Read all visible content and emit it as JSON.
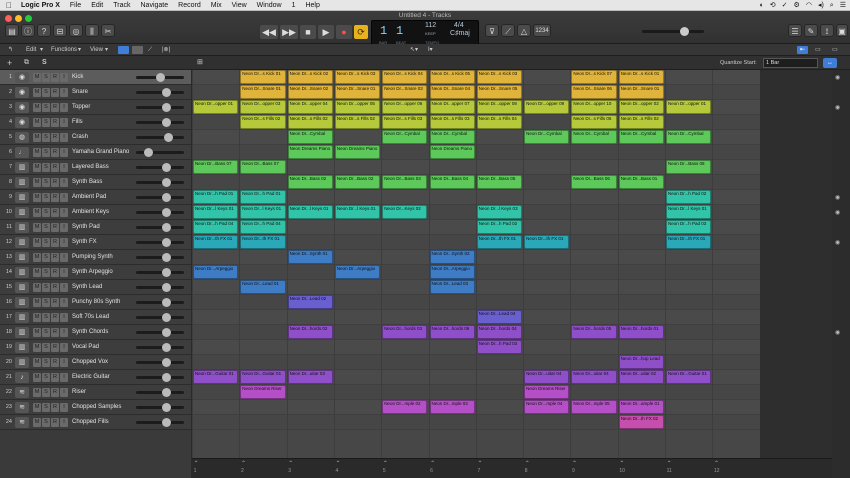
{
  "menubar": {
    "app": "Logic Pro X",
    "items": [
      "File",
      "Edit",
      "Track",
      "Navigate",
      "Record",
      "Mix",
      "View",
      "Window",
      "1",
      "Help"
    ],
    "clock": "⏱"
  },
  "window": {
    "title": "Untitled 4 - Tracks"
  },
  "lcd": {
    "bar": "1",
    "beat": "1",
    "bar_label": "BAR",
    "beat_label": "BEAT",
    "tempo": "112",
    "tempo_label": "KEEP",
    "tempo_sub": "TEMPO",
    "signature": "4/4",
    "key": "C♯maj"
  },
  "countin": "1234",
  "toolbar": {
    "edit": "Edit",
    "functions": "Functions",
    "view": "View",
    "quantize_label": "Quantize Start:",
    "quantize_value": "1 Bar"
  },
  "colors": {
    "yellow": "#e0b43a",
    "lime": "#b5c93a",
    "green": "#5cc95a",
    "cyan": "#32c4a8",
    "teal": "#2aa8b7",
    "blue": "#3e7cc6",
    "indigo": "#6a5fcf",
    "purple": "#8f4fc8",
    "magenta": "#b54fc8",
    "pink": "#c64fae"
  },
  "tracks": [
    {
      "num": "1",
      "name": "Kick",
      "icon": "drum-icon",
      "sel": true
    },
    {
      "num": "2",
      "name": "Snare",
      "icon": "drum-icon"
    },
    {
      "num": "3",
      "name": "Topper",
      "icon": "drum-icon"
    },
    {
      "num": "4",
      "name": "Fills",
      "icon": "drum-icon"
    },
    {
      "num": "5",
      "name": "Crash",
      "icon": "cymbal-icon"
    },
    {
      "num": "6",
      "name": "Yamaha Grand Piano",
      "icon": "piano-icon"
    },
    {
      "num": "7",
      "name": "Layered Bass",
      "icon": "keyboard-icon"
    },
    {
      "num": "8",
      "name": "Synth Bass",
      "icon": "keyboard-icon"
    },
    {
      "num": "9",
      "name": "Ambient Pad",
      "icon": "keyboard-icon"
    },
    {
      "num": "10",
      "name": "Ambient Keys",
      "icon": "keyboard-icon"
    },
    {
      "num": "11",
      "name": "Synth Pad",
      "icon": "keyboard-icon"
    },
    {
      "num": "12",
      "name": "Synth FX",
      "icon": "keyboard-icon"
    },
    {
      "num": "13",
      "name": "Pumping Synth",
      "icon": "keyboard-icon"
    },
    {
      "num": "14",
      "name": "Synth Arpeggio",
      "icon": "keyboard-icon"
    },
    {
      "num": "15",
      "name": "Synth Lead",
      "icon": "keyboard-icon"
    },
    {
      "num": "16",
      "name": "Punchy 80s Synth",
      "icon": "keyboard-icon"
    },
    {
      "num": "17",
      "name": "Soft 70s Lead",
      "icon": "keyboard-icon"
    },
    {
      "num": "18",
      "name": "Synth Chords",
      "icon": "keyboard-icon"
    },
    {
      "num": "19",
      "name": "Vocal Pad",
      "icon": "keyboard-icon"
    },
    {
      "num": "20",
      "name": "Chopped Vox",
      "icon": "keyboard-icon"
    },
    {
      "num": "21",
      "name": "Electric Guitar",
      "icon": "guitar-icon"
    },
    {
      "num": "22",
      "name": "Riser",
      "icon": "waveform-icon"
    },
    {
      "num": "23",
      "name": "Chopped Samples",
      "icon": "waveform-icon"
    },
    {
      "num": "24",
      "name": "Chopped Fills",
      "icon": "waveform-icon"
    }
  ],
  "bars": [
    "1",
    "2",
    "3",
    "4",
    "5",
    "6",
    "7",
    "8",
    "9",
    "10",
    "11",
    "12"
  ],
  "regions": [
    {
      "t": 0,
      "b": 2,
      "l": 1,
      "c": "yellow",
      "n": "Neon Dr...s Kick 01"
    },
    {
      "t": 0,
      "b": 3,
      "l": 1,
      "c": "yellow",
      "n": "Neon Dr...s Kick 02"
    },
    {
      "t": 0,
      "b": 4,
      "l": 1,
      "c": "yellow",
      "n": "Neon Dr...s Kick 03"
    },
    {
      "t": 0,
      "b": 5,
      "l": 1,
      "c": "yellow",
      "n": "Neon Dr...s Kick 04"
    },
    {
      "t": 0,
      "b": 6,
      "l": 1,
      "c": "yellow",
      "n": "Neon Dr...s Kick 05"
    },
    {
      "t": 0,
      "b": 7,
      "l": 1,
      "c": "yellow",
      "n": "Neon Dr...s Kick 03"
    },
    {
      "t": 0,
      "b": 9,
      "l": 1,
      "c": "yellow",
      "n": "Neon Dr...s Kick 07"
    },
    {
      "t": 0,
      "b": 10,
      "l": 1,
      "c": "yellow",
      "n": "Neon Dr...s Kick 01"
    },
    {
      "t": 1,
      "b": 2,
      "l": 1,
      "c": "yellow",
      "n": "Neon Dr...Snare 01"
    },
    {
      "t": 1,
      "b": 3,
      "l": 1,
      "c": "yellow",
      "n": "Neon Dr...Snare 02"
    },
    {
      "t": 1,
      "b": 4,
      "l": 1,
      "c": "yellow",
      "n": "Neon Dr...Snare 01"
    },
    {
      "t": 1,
      "b": 5,
      "l": 1,
      "c": "yellow",
      "n": "Neon Dr...Snare 03"
    },
    {
      "t": 1,
      "b": 6,
      "l": 1,
      "c": "yellow",
      "n": "Neon Dr...Snare 04"
    },
    {
      "t": 1,
      "b": 7,
      "l": 1,
      "c": "yellow",
      "n": "Neon Dr...Snare 05"
    },
    {
      "t": 1,
      "b": 9,
      "l": 1,
      "c": "yellow",
      "n": "Neon Dr...Snare 06"
    },
    {
      "t": 1,
      "b": 10,
      "l": 1,
      "c": "yellow",
      "n": "Neon Dr...Snare 01"
    },
    {
      "t": 2,
      "b": 1,
      "l": 1,
      "c": "lime",
      "n": "Neon Dr...opper 01"
    },
    {
      "t": 2,
      "b": 2,
      "l": 1,
      "c": "lime",
      "n": "Neon Dr...opper 03"
    },
    {
      "t": 2,
      "b": 3,
      "l": 1,
      "c": "lime",
      "n": "Neon Dr...opper 04"
    },
    {
      "t": 2,
      "b": 4,
      "l": 1,
      "c": "lime",
      "n": "Neon Dr...opper 05"
    },
    {
      "t": 2,
      "b": 5,
      "l": 1,
      "c": "lime",
      "n": "Neon Dr...opper 06"
    },
    {
      "t": 2,
      "b": 6,
      "l": 1,
      "c": "lime",
      "n": "Neon Dr...opper 07"
    },
    {
      "t": 2,
      "b": 7,
      "l": 1,
      "c": "lime",
      "n": "Neon Dr...opper 08"
    },
    {
      "t": 2,
      "b": 8,
      "l": 1,
      "c": "lime",
      "n": "Neon Dr...opper 09"
    },
    {
      "t": 2,
      "b": 9,
      "l": 1,
      "c": "lime",
      "n": "Neon Dr...opper 10"
    },
    {
      "t": 2,
      "b": 10,
      "l": 1,
      "c": "lime",
      "n": "Neon Dr...opper 02"
    },
    {
      "t": 2,
      "b": 11,
      "l": 1,
      "c": "lime",
      "n": "Neon Dr...opper 01"
    },
    {
      "t": 3,
      "b": 2,
      "l": 1,
      "c": "lime",
      "n": "Neon Dr...s Fills 02"
    },
    {
      "t": 3,
      "b": 3,
      "l": 1,
      "c": "lime",
      "n": "Neon Dr...s Fills 02"
    },
    {
      "t": 3,
      "b": 4,
      "l": 1,
      "c": "lime",
      "n": "Neon Dr...s Fills 02"
    },
    {
      "t": 3,
      "b": 5,
      "l": 1,
      "c": "lime",
      "n": "Neon Dr...s Fills 03"
    },
    {
      "t": 3,
      "b": 6,
      "l": 1,
      "c": "lime",
      "n": "Neon Dr...s Fills 03"
    },
    {
      "t": 3,
      "b": 7,
      "l": 1,
      "c": "lime",
      "n": "Neon Dr...s Fills 04"
    },
    {
      "t": 3,
      "b": 9,
      "l": 1,
      "c": "lime",
      "n": "Neon Dr...s Fills 05"
    },
    {
      "t": 3,
      "b": 10,
      "l": 1,
      "c": "lime",
      "n": "Neon Dr...s Fills 02"
    },
    {
      "t": 4,
      "b": 3,
      "l": 1,
      "c": "green",
      "n": "Neon Dr...Cymbal"
    },
    {
      "t": 4,
      "b": 5,
      "l": 1,
      "c": "green",
      "n": "Neon Dr...Cymbal"
    },
    {
      "t": 4,
      "b": 6,
      "l": 1,
      "c": "green",
      "n": "Neon Dr...Cymbal"
    },
    {
      "t": 4,
      "b": 8,
      "l": 1,
      "c": "green",
      "n": "Neon Dr...Cymbal"
    },
    {
      "t": 4,
      "b": 9,
      "l": 1,
      "c": "green",
      "n": "Neon Dr...Cymbal"
    },
    {
      "t": 4,
      "b": 10,
      "l": 1,
      "c": "green",
      "n": "Neon Dr...Cymbal"
    },
    {
      "t": 4,
      "b": 11,
      "l": 1,
      "c": "green",
      "n": "Neon Dr...Cymbal"
    },
    {
      "t": 5,
      "b": 3,
      "l": 1,
      "c": "green",
      "n": "Neon Dreams Piano"
    },
    {
      "t": 5,
      "b": 4,
      "l": 1,
      "c": "green",
      "n": "Neon Dreams Piano"
    },
    {
      "t": 5,
      "b": 6,
      "l": 1,
      "c": "green",
      "n": "Neon Dreams Piano"
    },
    {
      "t": 6,
      "b": 1,
      "l": 1,
      "c": "green",
      "n": "Neon Dr...Bass 07"
    },
    {
      "t": 6,
      "b": 2,
      "l": 1,
      "c": "green",
      "n": "Neon Dr...Bass 07"
    },
    {
      "t": 6,
      "b": 11,
      "l": 1,
      "c": "green",
      "n": "Neon Dr...Bass 08"
    },
    {
      "t": 7,
      "b": 3,
      "l": 1,
      "c": "green",
      "n": "Neon Dr...Bass 02"
    },
    {
      "t": 7,
      "b": 4,
      "l": 1,
      "c": "green",
      "n": "Neon Dr...Bass 02"
    },
    {
      "t": 7,
      "b": 5,
      "l": 1,
      "c": "green",
      "n": "Neon Dr...Bass 03"
    },
    {
      "t": 7,
      "b": 6,
      "l": 1,
      "c": "green",
      "n": "Neon Dr...Bass 04"
    },
    {
      "t": 7,
      "b": 7,
      "l": 1,
      "c": "green",
      "n": "Neon Dr...Bass 05"
    },
    {
      "t": 7,
      "b": 9,
      "l": 1,
      "c": "green",
      "n": "Neon Dr...Bass 06"
    },
    {
      "t": 7,
      "b": 10,
      "l": 1,
      "c": "green",
      "n": "Neon Dr...Bass 01"
    },
    {
      "t": 8,
      "b": 1,
      "l": 1,
      "c": "cyan",
      "n": "Neon Dr...h Pad 01"
    },
    {
      "t": 8,
      "b": 2,
      "l": 1,
      "c": "cyan",
      "n": "Neon Dr...h Pad 01"
    },
    {
      "t": 8,
      "b": 11,
      "l": 1,
      "c": "cyan",
      "n": "Neon Dr...h Pad 02"
    },
    {
      "t": 9,
      "b": 1,
      "l": 1,
      "c": "cyan",
      "n": "Neon Dr...l Keys 01"
    },
    {
      "t": 9,
      "b": 2,
      "l": 1,
      "c": "cyan",
      "n": "Neon Dr...l Keys 01"
    },
    {
      "t": 9,
      "b": 3,
      "l": 1,
      "c": "cyan",
      "n": "Neon Dr...l Keys 01"
    },
    {
      "t": 9,
      "b": 4,
      "l": 1,
      "c": "cyan",
      "n": "Neon Dr...l Keys 01"
    },
    {
      "t": 9,
      "b": 5,
      "l": 1,
      "c": "cyan",
      "n": "Neon Dr...Keys 02"
    },
    {
      "t": 9,
      "b": 7,
      "l": 1,
      "c": "cyan",
      "n": "Neon Dr...l Keys 03"
    },
    {
      "t": 9,
      "b": 11,
      "l": 1,
      "c": "cyan",
      "n": "Neon Dr...l Keys 01"
    },
    {
      "t": 10,
      "b": 1,
      "l": 1,
      "c": "cyan",
      "n": "Neon Dr...h Pad 04"
    },
    {
      "t": 10,
      "b": 2,
      "l": 1,
      "c": "cyan",
      "n": "Neon Dr...h Pad 04"
    },
    {
      "t": 10,
      "b": 7,
      "l": 1,
      "c": "cyan",
      "n": "Neon Dr...h Pad 02"
    },
    {
      "t": 10,
      "b": 11,
      "l": 1,
      "c": "cyan",
      "n": "Neon Dr...h Pad 03"
    },
    {
      "t": 11,
      "b": 1,
      "l": 1,
      "c": "teal",
      "n": "Neon Dr...th FX 01"
    },
    {
      "t": 11,
      "b": 2,
      "l": 1,
      "c": "teal",
      "n": "Neon Dr...th FX 01"
    },
    {
      "t": 11,
      "b": 7,
      "l": 1,
      "c": "teal",
      "n": "Neon Dr...th FX 01"
    },
    {
      "t": 11,
      "b": 8,
      "l": 1,
      "c": "teal",
      "n": "Neon Dr...th FX 01"
    },
    {
      "t": 11,
      "b": 11,
      "l": 1,
      "c": "teal",
      "n": "Neon Dr...th FX 01"
    },
    {
      "t": 12,
      "b": 3,
      "l": 1,
      "c": "blue",
      "n": "Neon Dr...Synth 01"
    },
    {
      "t": 12,
      "b": 6,
      "l": 1,
      "c": "blue",
      "n": "Neon Dr...Synth 02"
    },
    {
      "t": 13,
      "b": 1,
      "l": 1,
      "c": "blue",
      "n": "Neon Dr...Arpeggio"
    },
    {
      "t": 13,
      "b": 4,
      "l": 1,
      "c": "blue",
      "n": "Neon Dr...Arpeggio"
    },
    {
      "t": 13,
      "b": 6,
      "l": 1,
      "c": "blue",
      "n": "Neon Dr...Arpeggio"
    },
    {
      "t": 14,
      "b": 2,
      "l": 1,
      "c": "blue",
      "n": "Neon Dr...Lead 01"
    },
    {
      "t": 14,
      "b": 6,
      "l": 1,
      "c": "blue",
      "n": "Neon Dr...Lead 03"
    },
    {
      "t": 15,
      "b": 3,
      "l": 1,
      "c": "indigo",
      "n": "Neon Dr...Lead 02"
    },
    {
      "t": 16,
      "b": 7,
      "l": 1,
      "c": "indigo",
      "n": "Neon Dr...Lead 04"
    },
    {
      "t": 17,
      "b": 3,
      "l": 1,
      "c": "purple",
      "n": "Neon Dr...hords 02"
    },
    {
      "t": 17,
      "b": 5,
      "l": 1,
      "c": "purple",
      "n": "Neon Dr...hords 03"
    },
    {
      "t": 17,
      "b": 6,
      "l": 1,
      "c": "purple",
      "n": "Neon Dr...hords 06"
    },
    {
      "t": 17,
      "b": 7,
      "l": 1,
      "c": "purple",
      "n": "Neon Dr...hords 04"
    },
    {
      "t": 17,
      "b": 9,
      "l": 1,
      "c": "purple",
      "n": "Neon Dr...hords 05"
    },
    {
      "t": 17,
      "b": 10,
      "l": 1,
      "c": "purple",
      "n": "Neon Dr...hords 01"
    },
    {
      "t": 18,
      "b": 7,
      "l": 1,
      "c": "purple",
      "n": "Neon Dr...h Pad 03"
    },
    {
      "t": 19,
      "b": 10,
      "l": 1,
      "c": "purple",
      "n": "Neon Dr...hop Lead"
    },
    {
      "t": 20,
      "b": 1,
      "l": 1,
      "c": "purple",
      "n": "Neon Dr...Guitar 01"
    },
    {
      "t": 20,
      "b": 2,
      "l": 1,
      "c": "purple",
      "n": "Neon Dr...Guitar 01"
    },
    {
      "t": 20,
      "b": 3,
      "l": 1,
      "c": "purple",
      "n": "Neon Dr...uitar 03"
    },
    {
      "t": 20,
      "b": 8,
      "l": 1,
      "c": "purple",
      "n": "Neon Dr...uitar 04"
    },
    {
      "t": 20,
      "b": 9,
      "l": 1,
      "c": "purple",
      "n": "Neon Dr...uitar 04"
    },
    {
      "t": 20,
      "b": 10,
      "l": 1,
      "c": "purple",
      "n": "Neon Dr...uitar 02"
    },
    {
      "t": 20,
      "b": 11,
      "l": 1,
      "c": "purple",
      "n": "Neon Dr...Guitar 01"
    },
    {
      "t": 21,
      "b": 2,
      "l": 1,
      "c": "magenta",
      "n": "Neon Dreams Riser"
    },
    {
      "t": 21,
      "b": 8,
      "l": 1,
      "c": "magenta",
      "n": "Neon Dreams Riser"
    },
    {
      "t": 22,
      "b": 5,
      "l": 1,
      "c": "magenta",
      "n": "Neon Dr...mple 02"
    },
    {
      "t": 22,
      "b": 6,
      "l": 1,
      "c": "magenta",
      "n": "Neon Dr...mple 03"
    },
    {
      "t": 22,
      "b": 8,
      "l": 1,
      "c": "magenta",
      "n": "Neon Dr...mple 04"
    },
    {
      "t": 22,
      "b": 9,
      "l": 1,
      "c": "magenta",
      "n": "Neon Dr...mple 05"
    },
    {
      "t": 22,
      "b": 10,
      "l": 1,
      "c": "magenta",
      "n": "Neon Dr...ample 01"
    },
    {
      "t": 23,
      "b": 10,
      "l": 1,
      "c": "pink",
      "n": "Neon Dr...th FX 02"
    }
  ]
}
